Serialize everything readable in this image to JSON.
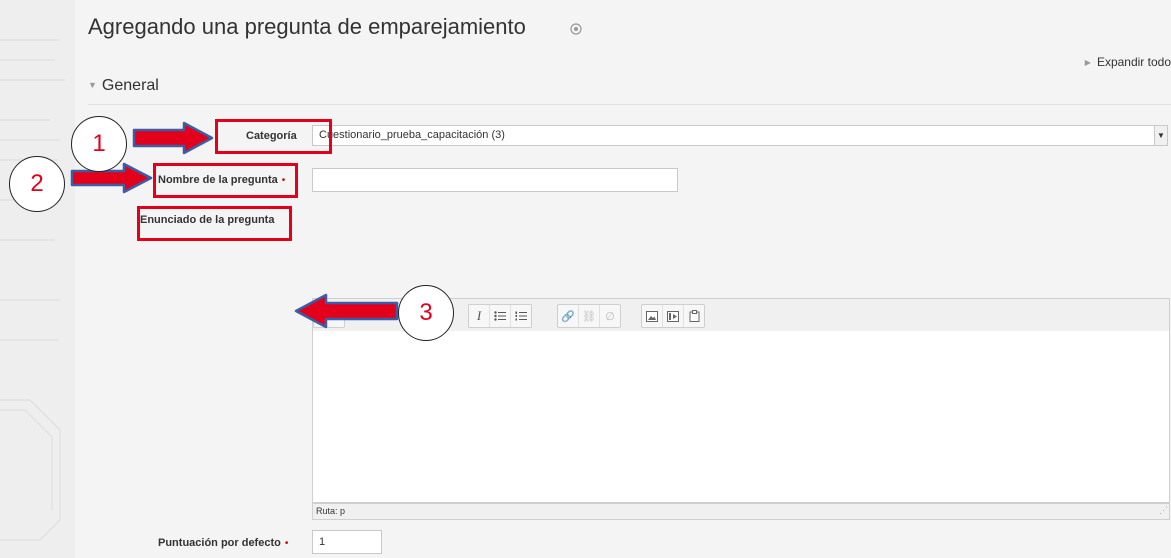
{
  "page": {
    "title": "Agregando una pregunta de emparejamiento",
    "expand_all": "Expandir todo",
    "section_general": "General"
  },
  "form": {
    "category_label": "Categoría",
    "category_value": "Cuestionario_prueba_capacitación (3)",
    "name_label": "Nombre de la pregunta",
    "name_value": "",
    "statement_label": "Enunciado de la pregunta",
    "editor_path": "Ruta: p",
    "default_mark_label": "Puntuación por defecto",
    "default_mark_value": "1",
    "required_mark": "•"
  },
  "toolbar": {
    "italic": "I"
  },
  "callouts": {
    "one": "1",
    "two": "2",
    "three": "3",
    "color": "#e3001b"
  },
  "icons": [
    "help-icon",
    "triangle-right-icon",
    "triangle-down-icon",
    "dropdown-arrow-icon",
    "italic-icon",
    "bullet-list-icon",
    "numbered-list-icon",
    "link-icon",
    "unlink-icon",
    "anchor-icon",
    "image-icon",
    "media-icon",
    "paste-icon",
    "resize-grip-icon"
  ]
}
